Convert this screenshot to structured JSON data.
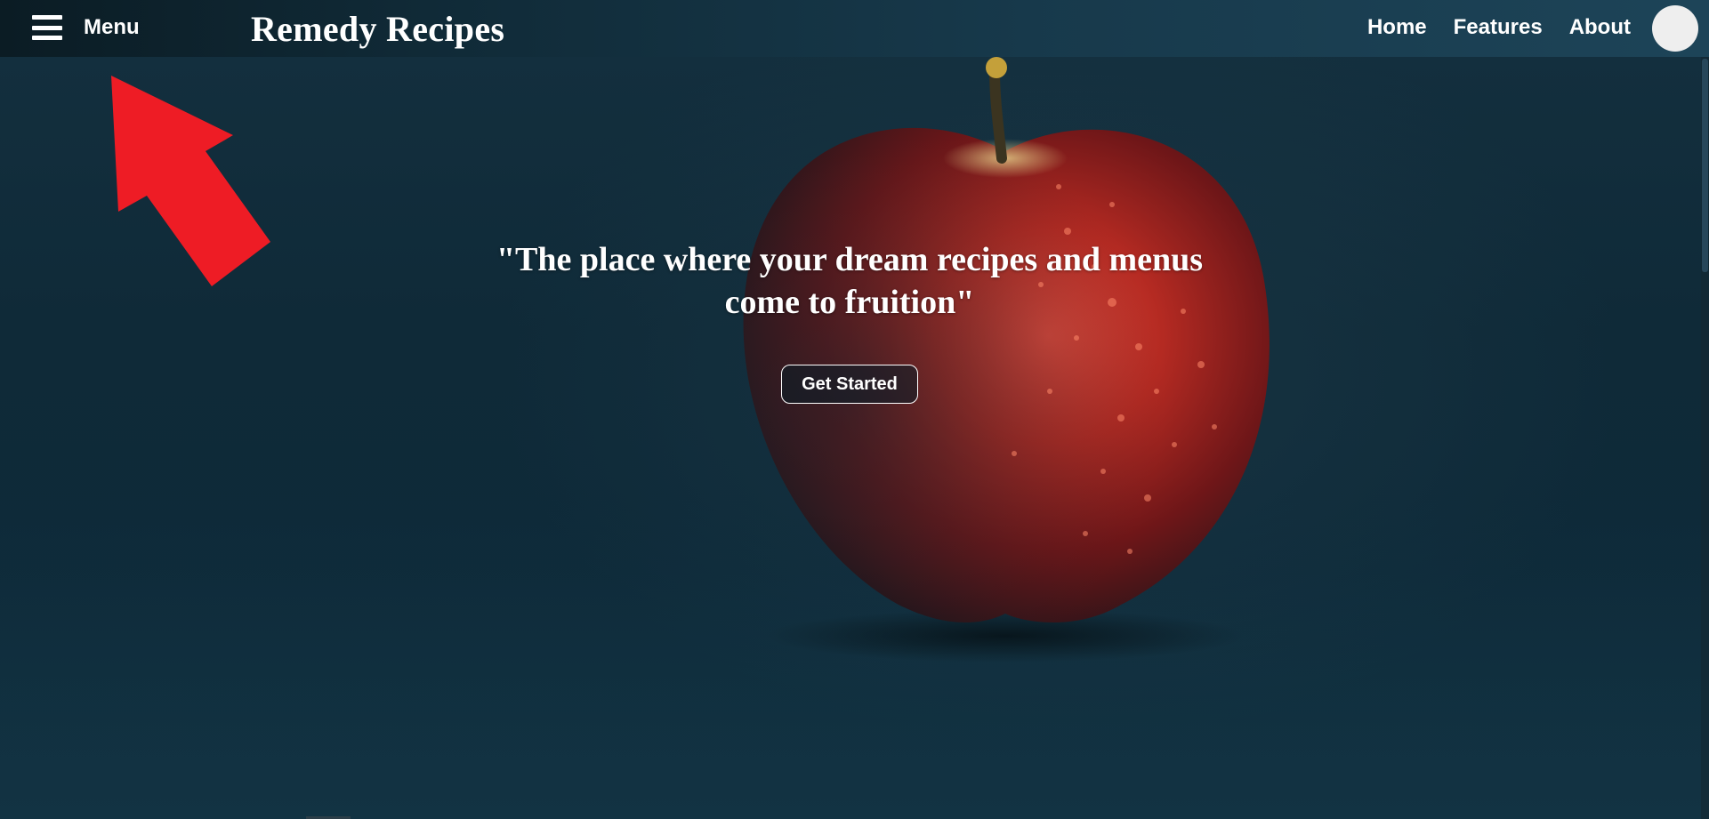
{
  "header": {
    "menu_label": "Menu",
    "brand": "Remedy Recipes",
    "nav": [
      "Home",
      "Features",
      "About"
    ]
  },
  "hero": {
    "tagline": "\"The place where your dream recipes and menus come to fruition\"",
    "cta_label": "Get Started"
  },
  "colors": {
    "background": "#0f2a38",
    "apple": "#b3261e",
    "annotation_arrow": "#ee1c25"
  }
}
